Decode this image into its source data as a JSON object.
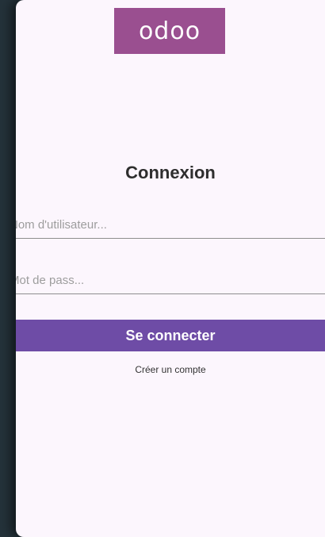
{
  "logo": {
    "text": "odoo"
  },
  "login": {
    "title": "Connexion",
    "username_placeholder": "Nom d'utilisateur...",
    "password_placeholder": "Mot de pass...",
    "submit_label": "Se connecter",
    "create_account_label": "Créer un compte"
  },
  "colors": {
    "brand": "#9a4f90",
    "button": "#6e4ca6",
    "background": "#fcf6fd"
  }
}
